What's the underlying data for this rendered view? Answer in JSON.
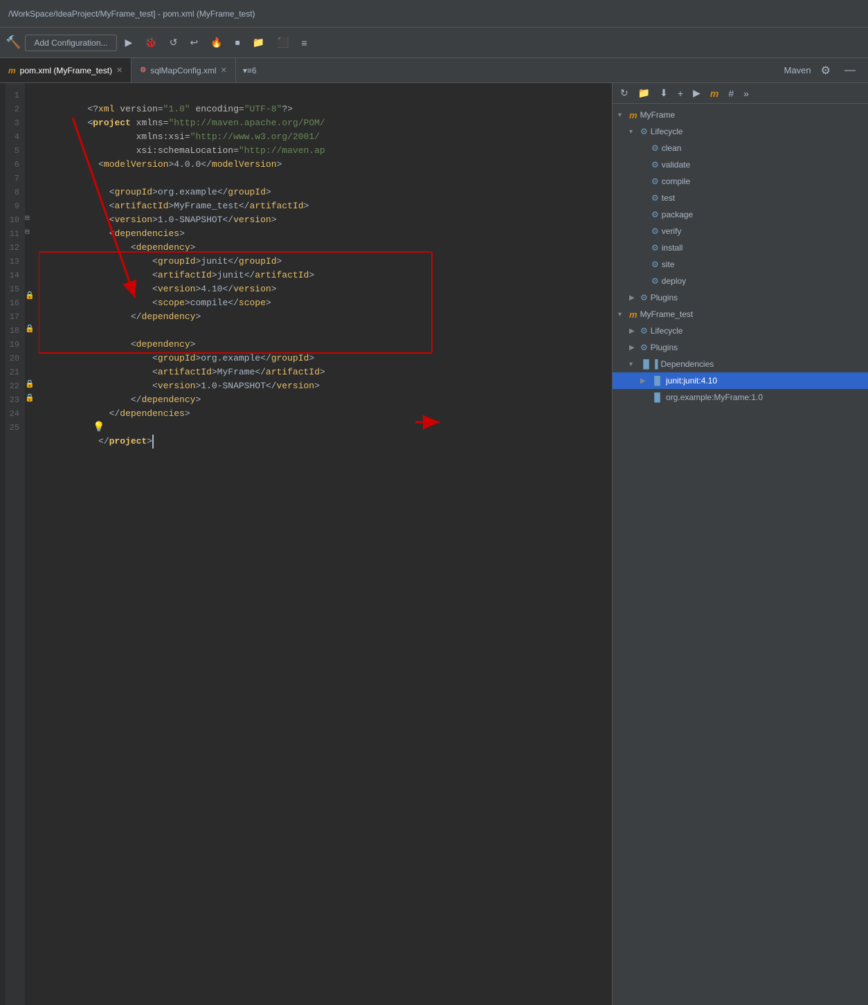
{
  "titleBar": {
    "text": "/WorkSpace/IdeaProject/MyFrame_test] - pom.xml (MyFrame_test)"
  },
  "toolbar": {
    "addConfig": "Add Configuration...",
    "buttons": [
      "▶",
      "⚙",
      "↩",
      "↺",
      "🐛",
      "⏹",
      "📁",
      "⬛",
      "≡"
    ]
  },
  "tabs": [
    {
      "id": "pom",
      "icon": "m",
      "label": "pom.xml (MyFrame_test)",
      "active": true
    },
    {
      "id": "sql",
      "icon": "sql",
      "label": "sqlMapConfig.xml",
      "active": false
    },
    {
      "id": "extra",
      "label": "▾≡6",
      "active": false
    }
  ],
  "maven": {
    "title": "Maven",
    "tree": [
      {
        "level": 0,
        "arrow": "▾",
        "icon": "folder",
        "label": "MyFrame",
        "type": "project"
      },
      {
        "level": 1,
        "arrow": "▾",
        "icon": "folder",
        "label": "Lifecycle",
        "type": "folder"
      },
      {
        "level": 2,
        "arrow": "",
        "icon": "gear",
        "label": "clean",
        "type": "lifecycle"
      },
      {
        "level": 2,
        "arrow": "",
        "icon": "gear",
        "label": "validate",
        "type": "lifecycle"
      },
      {
        "level": 2,
        "arrow": "",
        "icon": "gear",
        "label": "compile",
        "type": "lifecycle"
      },
      {
        "level": 2,
        "arrow": "",
        "icon": "gear",
        "label": "test",
        "type": "lifecycle"
      },
      {
        "level": 2,
        "arrow": "",
        "icon": "gear",
        "label": "package",
        "type": "lifecycle"
      },
      {
        "level": 2,
        "arrow": "",
        "icon": "gear",
        "label": "verify",
        "type": "lifecycle"
      },
      {
        "level": 2,
        "arrow": "",
        "icon": "gear",
        "label": "install",
        "type": "lifecycle"
      },
      {
        "level": 2,
        "arrow": "",
        "icon": "gear",
        "label": "site",
        "type": "lifecycle"
      },
      {
        "level": 2,
        "arrow": "",
        "icon": "gear",
        "label": "deploy",
        "type": "lifecycle"
      },
      {
        "level": 1,
        "arrow": "▶",
        "icon": "folder",
        "label": "Plugins",
        "type": "folder"
      },
      {
        "level": 0,
        "arrow": "▾",
        "icon": "folder",
        "label": "MyFrame_test",
        "type": "project"
      },
      {
        "level": 1,
        "arrow": "▶",
        "icon": "folder",
        "label": "Lifecycle",
        "type": "folder"
      },
      {
        "level": 1,
        "arrow": "▶",
        "icon": "folder",
        "label": "Plugins",
        "type": "folder"
      },
      {
        "level": 1,
        "arrow": "▾",
        "icon": "dep",
        "label": "Dependencies",
        "type": "folder"
      },
      {
        "level": 2,
        "arrow": "▶",
        "icon": "jar",
        "label": "junit:junit:4.10",
        "type": "dep",
        "selected": true
      },
      {
        "level": 2,
        "arrow": "",
        "icon": "jar",
        "label": "org.example:MyFrame:1.0",
        "type": "dep"
      }
    ]
  },
  "code": {
    "lines": [
      {
        "num": 1,
        "content": "  <?xml version=\"1.0\" encoding=\"UTF-8\"?>"
      },
      {
        "num": 2,
        "content": "  <project xmlns=\"http://maven.apache.org/POM/"
      },
      {
        "num": 3,
        "content": "           xmlns:xsi=\"http://www.w3.org/2001/"
      },
      {
        "num": 4,
        "content": "           xsi:schemaLocation=\"http://maven.ap"
      },
      {
        "num": 5,
        "content": "    <modelVersion>4.0.0</modelVersion>"
      },
      {
        "num": 6,
        "content": ""
      },
      {
        "num": 7,
        "content": "    <groupId>org.example</groupId>"
      },
      {
        "num": 8,
        "content": "    <artifactId>MyFrame_test</artifactId>"
      },
      {
        "num": 9,
        "content": "    <version>1.0-SNAPSHOT</version>"
      },
      {
        "num": 10,
        "content": "    <dependencies>"
      },
      {
        "num": 11,
        "content": "        <dependency>"
      },
      {
        "num": 12,
        "content": "            <groupId>junit</groupId>"
      },
      {
        "num": 13,
        "content": "            <artifactId>junit</artifactId>"
      },
      {
        "num": 14,
        "content": "            <version>4.10</version>"
      },
      {
        "num": 15,
        "content": "            <scope>compile</scope>"
      },
      {
        "num": 16,
        "content": "        </dependency>"
      },
      {
        "num": 17,
        "content": ""
      },
      {
        "num": 18,
        "content": "        <dependency>"
      },
      {
        "num": 19,
        "content": "            <groupId>org.example</groupId>"
      },
      {
        "num": 20,
        "content": "            <artifactId>MyFrame</artifactId>"
      },
      {
        "num": 21,
        "content": "            <version>1.0-SNAPSHOT</version>"
      },
      {
        "num": 22,
        "content": "        </dependency>"
      },
      {
        "num": 23,
        "content": "    </dependencies>"
      },
      {
        "num": 24,
        "content": ""
      },
      {
        "num": 25,
        "content": "  </project>"
      }
    ]
  }
}
